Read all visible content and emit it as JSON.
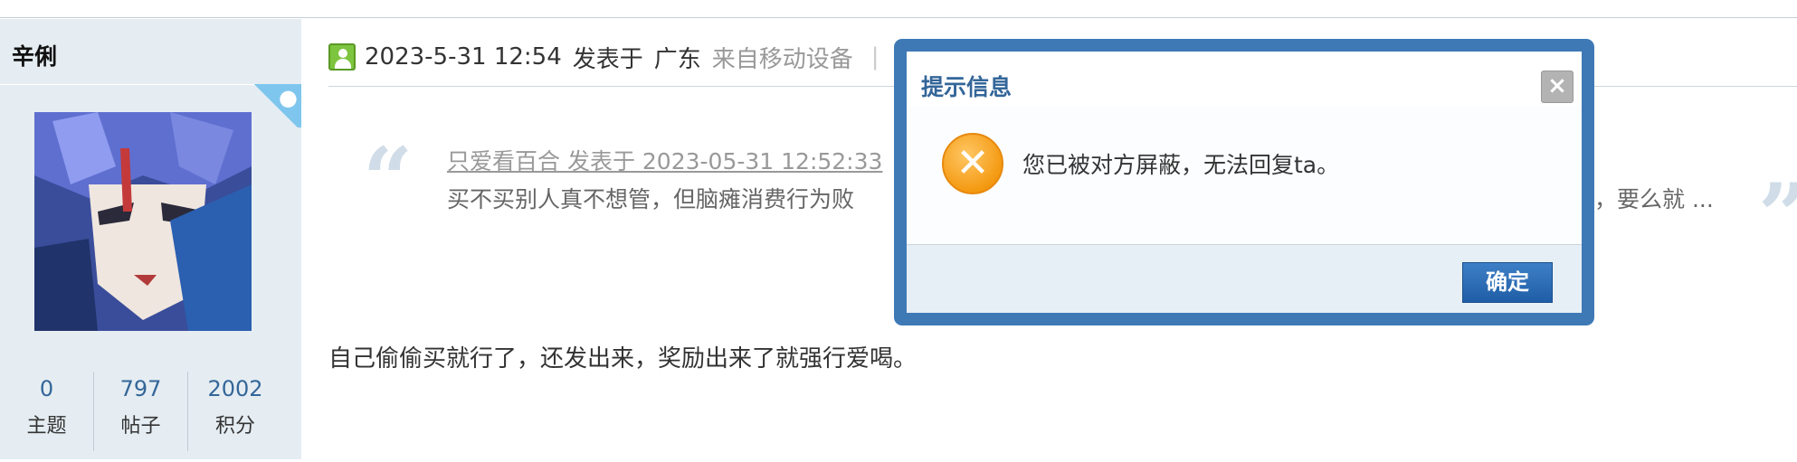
{
  "user": {
    "name": "辛俐",
    "stats": [
      {
        "value": "0",
        "label": "主题"
      },
      {
        "value": "797",
        "label": "帖子"
      },
      {
        "value": "2002",
        "label": "积分"
      }
    ]
  },
  "post": {
    "datetime": "2023-5-31 12:54",
    "posted_at_label": "发表于",
    "location": "广东",
    "device": "来自移动设备",
    "separator": "|",
    "quote": {
      "header": "只爱看百合 发表于 2023-05-31 12:52:33",
      "body": "买不买别人真不想管，但脑瘫消费行为败",
      "tail": "弱，要么就 ..."
    },
    "reply": "自己偷偷买就行了，还发出来，奖励出来了就强行爱喝。"
  },
  "dialog": {
    "title": "提示信息",
    "close_glyph": "×",
    "message": "您已被对方屏蔽，无法回复ta。",
    "confirm_label": "确定",
    "error_glyph": "✕"
  },
  "icons": {
    "online": "online-user-icon",
    "device_flag": "apple-icon",
    "error": "error-icon",
    "close": "close-icon"
  },
  "colors": {
    "sidebar_bg": "#e5edf2",
    "link_blue": "#336699",
    "dialog_border": "#3e79b6",
    "button_blue": "#2a6cb4",
    "error_orange": "#f49a12"
  }
}
